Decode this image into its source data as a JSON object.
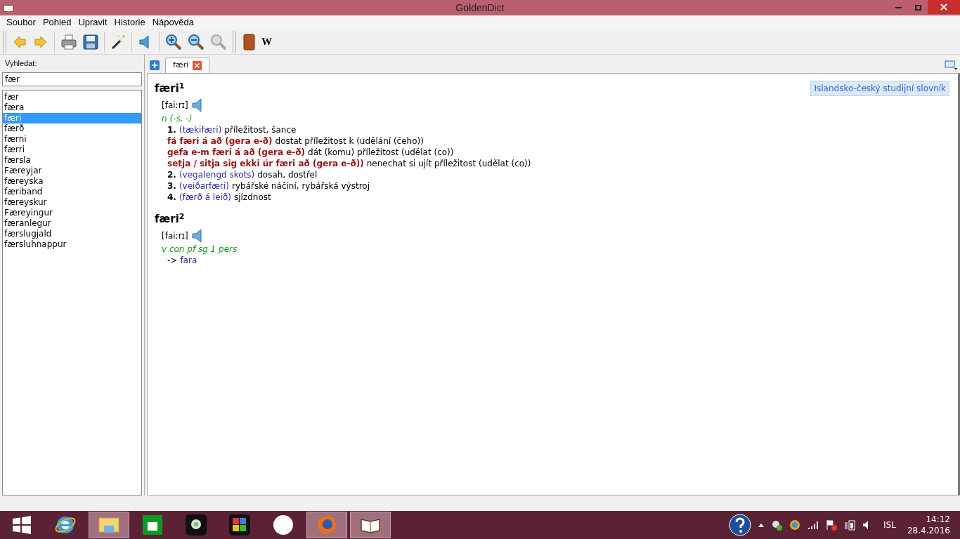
{
  "window": {
    "title": "GoldenDict"
  },
  "menu": [
    "Soubor",
    "Pohled",
    "Upravit",
    "Historie",
    "Nápověda"
  ],
  "toolbar": [
    {
      "kind": "back"
    },
    {
      "kind": "forward"
    },
    {
      "kind": "sep"
    },
    {
      "kind": "print"
    },
    {
      "kind": "save"
    },
    {
      "kind": "sep"
    },
    {
      "kind": "wand"
    },
    {
      "kind": "sep"
    },
    {
      "kind": "speaker"
    },
    {
      "kind": "sep"
    },
    {
      "kind": "zoomin"
    },
    {
      "kind": "zoomout"
    },
    {
      "kind": "zoomreset",
      "disabled": true
    },
    {
      "kind": "grip"
    },
    {
      "kind": "book"
    },
    {
      "kind": "wiki",
      "label": "W"
    }
  ],
  "search": {
    "label": "Vyhledat:",
    "value": "fær"
  },
  "words": [
    {
      "text": "fær",
      "selected": false
    },
    {
      "text": "færa",
      "selected": false
    },
    {
      "text": "færi",
      "selected": true
    },
    {
      "text": "færð",
      "selected": false
    },
    {
      "text": "færni",
      "selected": false
    },
    {
      "text": "færri",
      "selected": false
    },
    {
      "text": "færsla",
      "selected": false
    },
    {
      "text": "Færeyjar",
      "selected": false
    },
    {
      "text": "færeyska",
      "selected": false
    },
    {
      "text": "færiband",
      "selected": false
    },
    {
      "text": "færeyskur",
      "selected": false
    },
    {
      "text": "Færeyingur",
      "selected": false
    },
    {
      "text": "færanlegur",
      "selected": false
    },
    {
      "text": "færslugjald",
      "selected": false
    },
    {
      "text": "færsluhnappur",
      "selected": false
    }
  ],
  "tabs": [
    {
      "label": "færi",
      "selected": true
    }
  ],
  "dictionary_label": "Islandsko-český studijní slovník",
  "entries": [
    {
      "headword": "færi",
      "sup": "1",
      "pron": "[fai:rɪ]",
      "grammar": "n (-s, -)",
      "lines": [
        {
          "kind": "sense",
          "num": "1.",
          "note": "(tækifæri)",
          "text": "příležitost, šance"
        },
        {
          "kind": "phrase",
          "phrase": "fá færi á að (gera e-ð)",
          "text": "dostat příležitost k (udělání (čeho))"
        },
        {
          "kind": "phrase",
          "phrase": "gefa e-m færi á að (gera e-ð)",
          "text": "dát (komu) příležitost (udělat (co))"
        },
        {
          "kind": "phrase",
          "phrase": "setja / sitja sig ekki úr færi að (gera e-ð))",
          "text": "nenechat si ujít příležitost (udělat (co))"
        },
        {
          "kind": "sense",
          "num": "2.",
          "note": "(vegalengd skots)",
          "text": "dosah, dostřel"
        },
        {
          "kind": "sense",
          "num": "3.",
          "note": "(veiðarfæri)",
          "text": "rybářské náčiní, rybářská výstroj"
        },
        {
          "kind": "sense",
          "num": "4.",
          "note": "(færð á leið)",
          "text": "sjízdnost"
        }
      ]
    },
    {
      "headword": "færi",
      "sup": "2",
      "pron": "[fai:rɪ]",
      "grammar": "v con pf sg 1 pers",
      "lines": [
        {
          "kind": "ref",
          "arrow": "->",
          "link": "fara"
        }
      ]
    }
  ],
  "taskbar": [
    {
      "kind": "start",
      "running": false
    },
    {
      "kind": "ie",
      "running": false
    },
    {
      "kind": "explorer",
      "running": true
    },
    {
      "kind": "store",
      "running": false
    },
    {
      "kind": "webcam",
      "running": false
    },
    {
      "kind": "puzzle",
      "running": false
    },
    {
      "kind": "hp",
      "running": false
    },
    {
      "kind": "firefox",
      "running": true
    },
    {
      "kind": "book",
      "running": true
    }
  ],
  "tray": {
    "language": "ISL",
    "time": "14:12",
    "date": "28.4.2016"
  }
}
